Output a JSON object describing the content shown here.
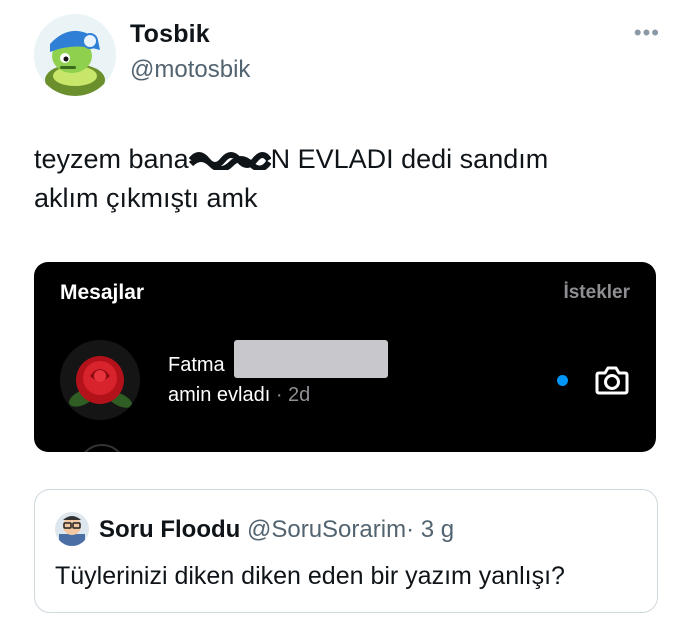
{
  "tweet": {
    "author": {
      "display_name": "Tosbik",
      "handle": "@motosbik",
      "avatar_icon": "turtle-avatar-icon"
    },
    "more_icon": "more-options-icon",
    "text_before_censor": "teyzem bana",
    "text_after_censor": "N EVLADI dedi sandım",
    "text_line2": "aklım çıkmıştı amk"
  },
  "dm_screenshot": {
    "title": "Mesajlar",
    "requests_label": "İstekler",
    "conversation": {
      "name": "Fatma",
      "preview": "amin evladı",
      "time": "· 2d",
      "unread": true,
      "avatar_icon": "rose-avatar-icon",
      "camera_icon": "camera-icon"
    },
    "colors": {
      "background": "#000000",
      "unread_dot": "#0095f6"
    }
  },
  "quoted_tweet": {
    "display_name": "Soru Floodu",
    "handle": "@SoruSorarim",
    "time": "· 3 g",
    "text": "Tüylerinizi diken diken eden bir yazım yanlışı?",
    "avatar_icon": "cartoon-avatar-icon"
  }
}
